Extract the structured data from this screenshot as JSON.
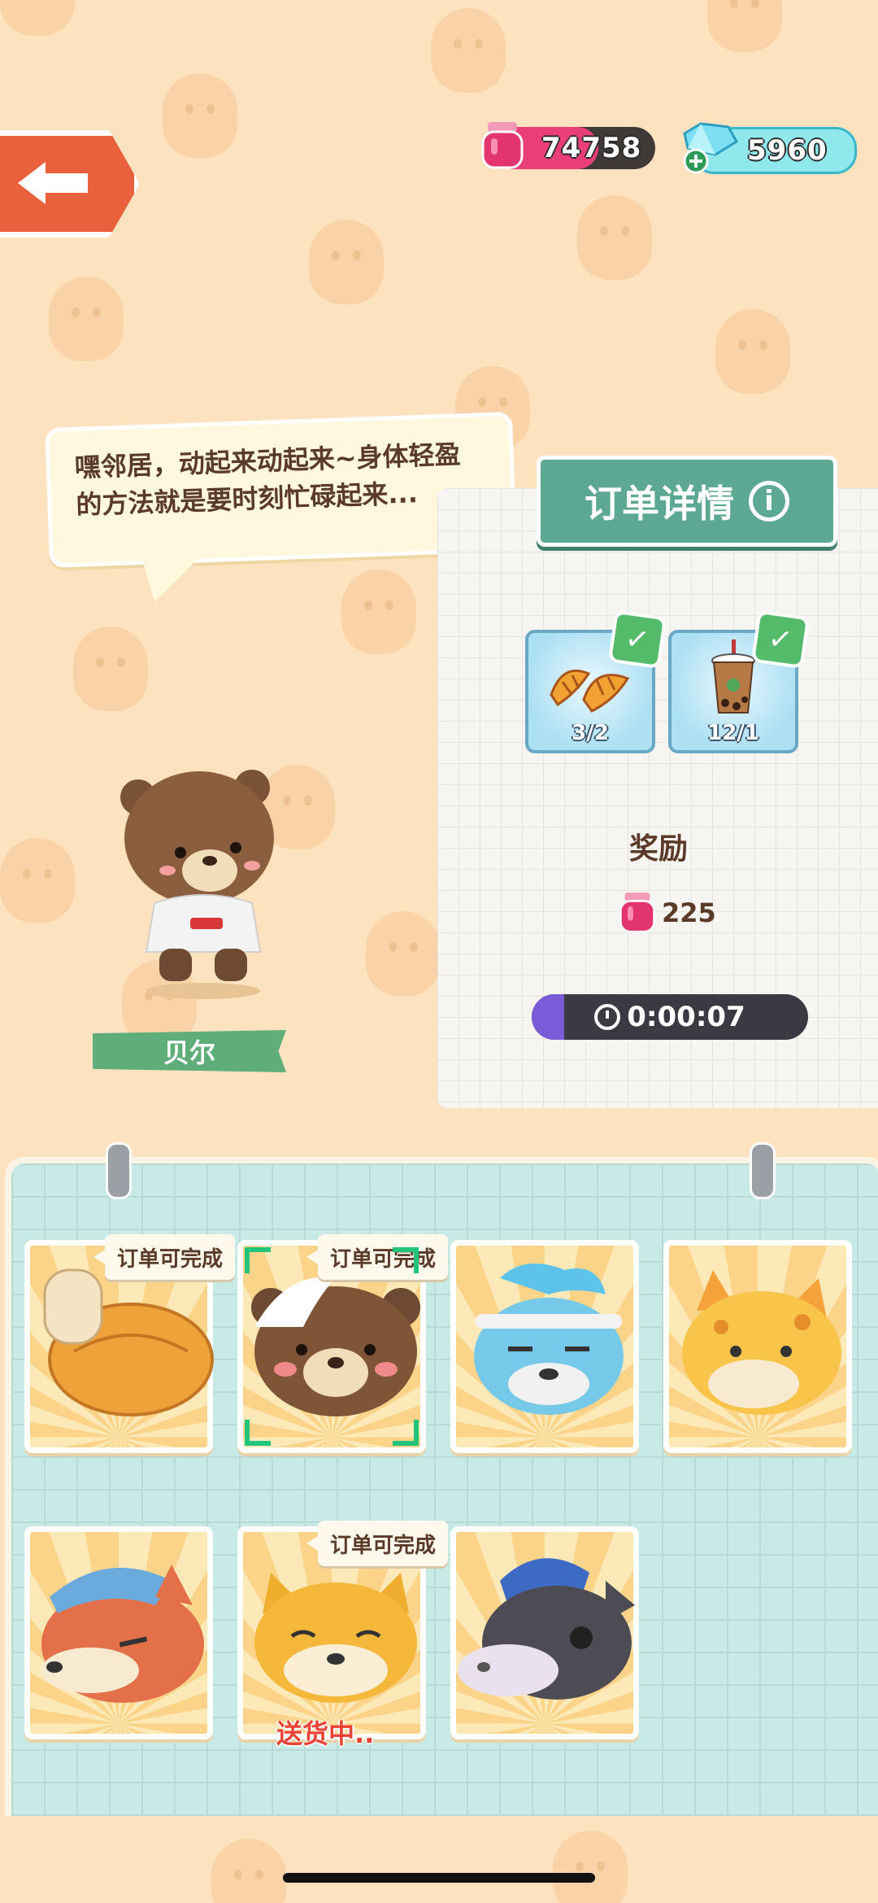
{
  "currency": {
    "jam": {
      "value": "74758",
      "icon": "jam-jar-icon"
    },
    "gems": {
      "value": "5960",
      "icon": "gem-icon"
    }
  },
  "speech": {
    "text": "嘿邻居，动起来动起来~身体轻盈的方法就是要时刻忙碌起来..."
  },
  "character": {
    "name": "贝尔"
  },
  "order": {
    "title": "订单详情",
    "items": [
      {
        "name": "croissant",
        "count": "3/2",
        "done": true
      },
      {
        "name": "bubble-tea",
        "count": "12/1",
        "done": true
      }
    ],
    "reward_label": "奖励",
    "reward_value": "225",
    "timer": "0:00:07"
  },
  "customers": [
    {
      "id": "bread-roll",
      "badge": "订单可完成"
    },
    {
      "id": "bear",
      "badge": "订单可完成",
      "selected": true
    },
    {
      "id": "blue-wolf",
      "badge": ""
    },
    {
      "id": "giraffe-cat",
      "badge": ""
    },
    {
      "id": "fox-cap",
      "badge": ""
    },
    {
      "id": "shiba",
      "badge": "订单可完成",
      "status": "送货中.."
    },
    {
      "id": "donkey",
      "badge": ""
    }
  ],
  "colors": {
    "background": "#fde2c0",
    "accent_green": "#5da892",
    "back_button": "#e9603c",
    "jam": "#e93e78",
    "gem": "#8ee8ec",
    "delivering": "#ea4335"
  }
}
